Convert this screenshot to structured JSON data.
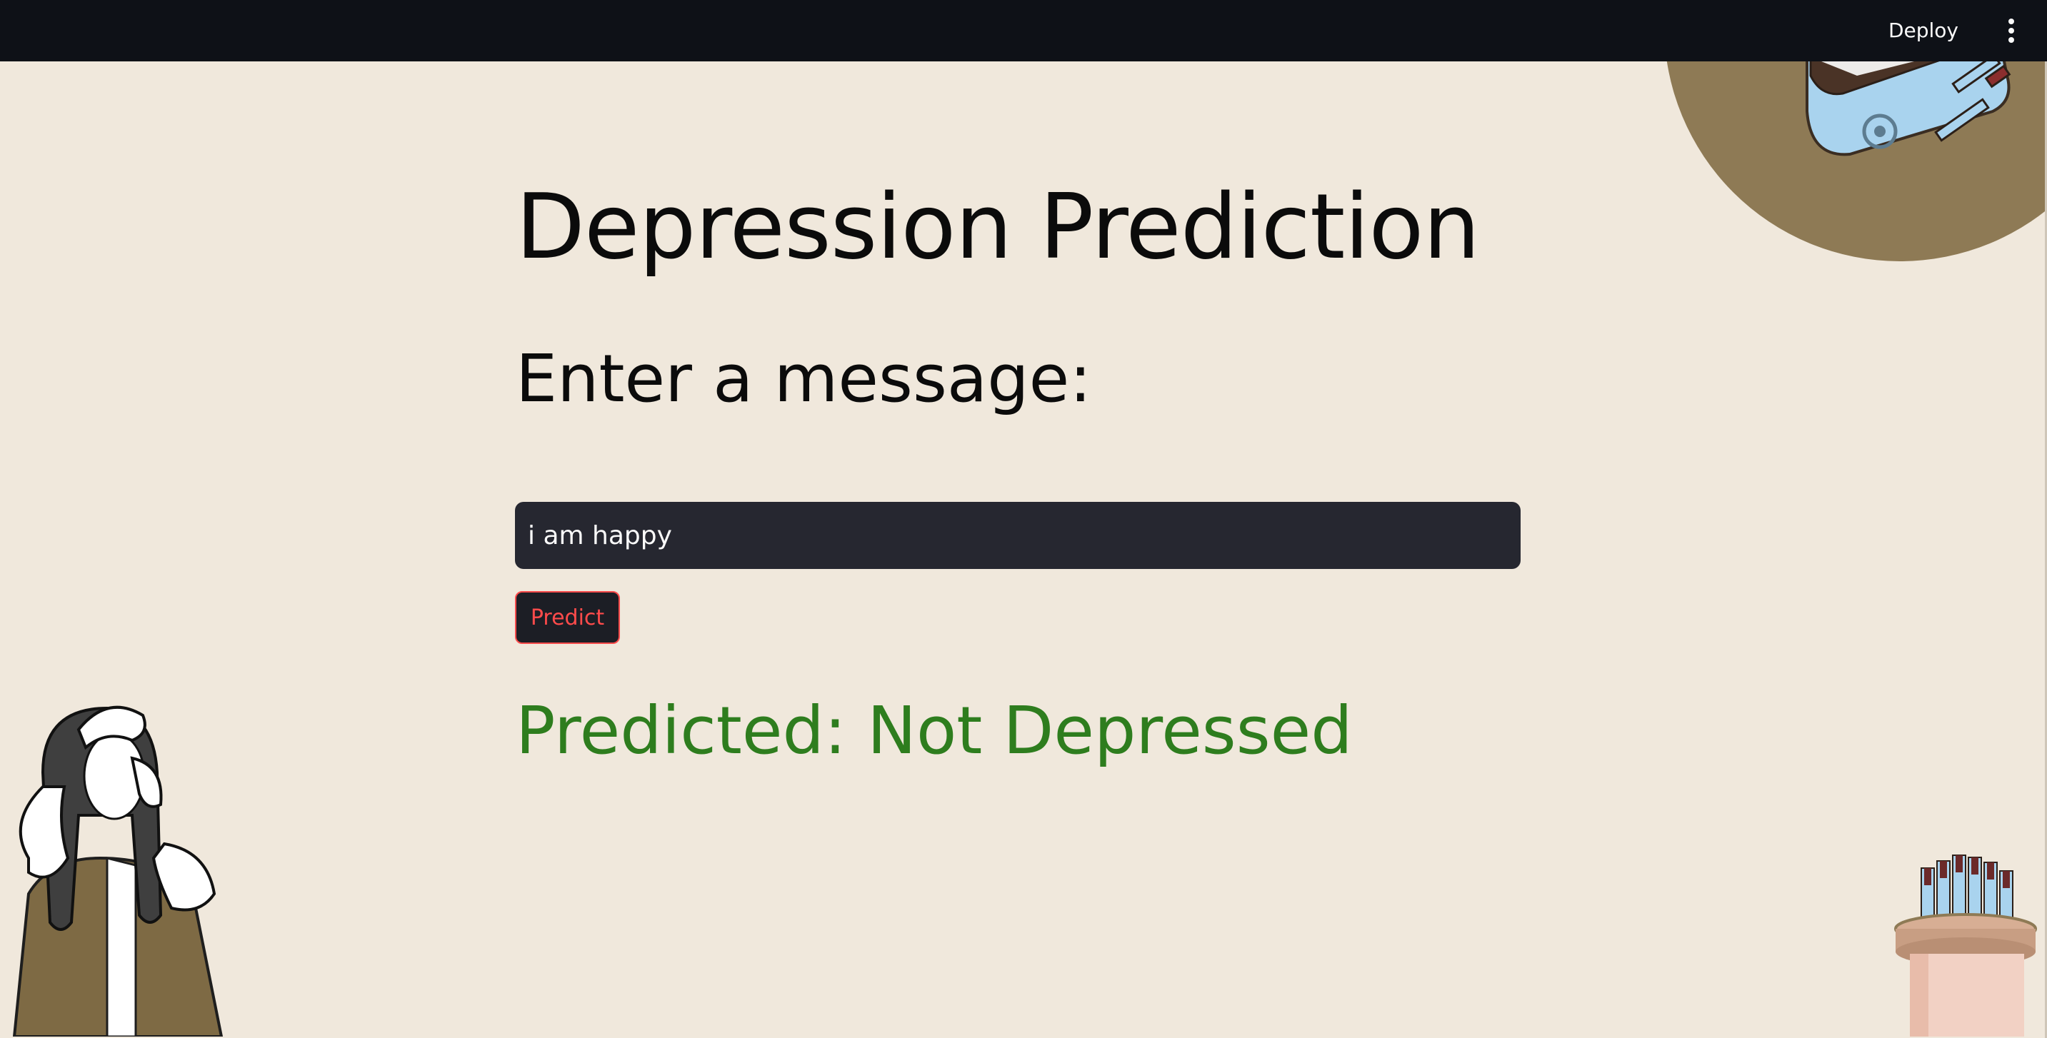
{
  "header": {
    "deploy_label": "Deploy",
    "menu_icon": "vertical-ellipsis-icon"
  },
  "main": {
    "title": "Depression Prediction",
    "input_label": "Enter a message:",
    "input_value": "i am happy",
    "predict_label": "Predict",
    "result_text": "Predicted: Not Depressed"
  },
  "colors": {
    "background": "#F0E8DC",
    "topbar": "#0E1117",
    "input_bg": "#262730",
    "button_accent": "#FF4B4B",
    "result_green": "#2E7D1E",
    "decor_brown": "#8E7A55"
  },
  "decorations": {
    "top_right": "glucose-meter-illustration",
    "bottom_left": "stressed-woman-illustration",
    "bottom_right": "test-strip-container-illustration"
  }
}
